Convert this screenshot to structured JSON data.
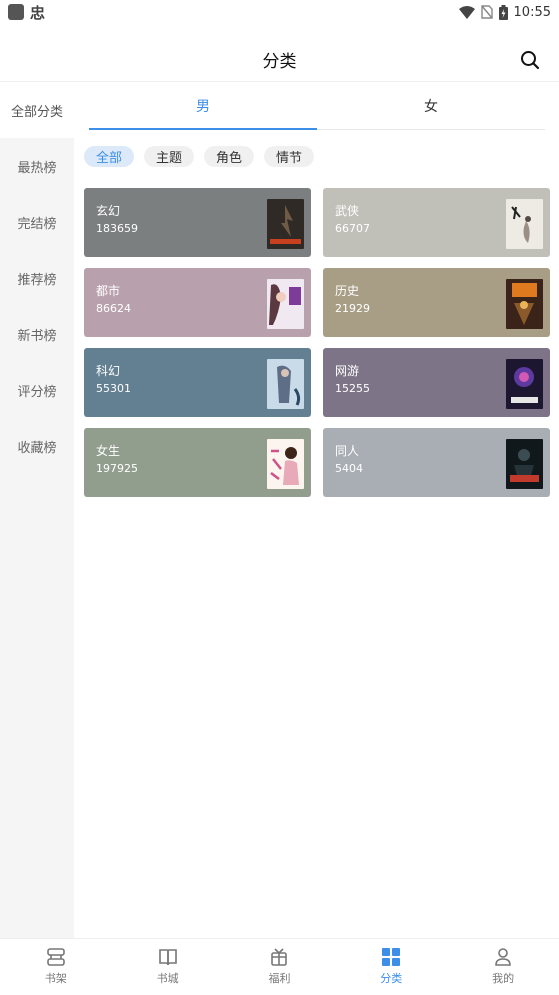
{
  "status_bar": {
    "glyph": "忠",
    "time": "10:55"
  },
  "header": {
    "title": "分类",
    "search_icon": "search-icon"
  },
  "sidebar": {
    "items": [
      {
        "label": "全部分类",
        "active": true
      },
      {
        "label": "最热榜",
        "active": false
      },
      {
        "label": "完结榜",
        "active": false
      },
      {
        "label": "推荐榜",
        "active": false
      },
      {
        "label": "新书榜",
        "active": false
      },
      {
        "label": "评分榜",
        "active": false
      },
      {
        "label": "收藏榜",
        "active": false
      }
    ]
  },
  "gender_tabs": [
    {
      "label": "男",
      "active": true
    },
    {
      "label": "女",
      "active": false
    }
  ],
  "chips": [
    {
      "label": "全部",
      "active": true
    },
    {
      "label": "主题",
      "active": false
    },
    {
      "label": "角色",
      "active": false
    },
    {
      "label": "情节",
      "active": false
    }
  ],
  "categories": [
    {
      "name": "玄幻",
      "count": "183659",
      "color": "#7b7f80"
    },
    {
      "name": "武侠",
      "count": "66707",
      "color": "#c0c0b9"
    },
    {
      "name": "都市",
      "count": "86624",
      "color": "#b9a0ad"
    },
    {
      "name": "历史",
      "count": "21929",
      "color": "#a89e85"
    },
    {
      "name": "科幻",
      "count": "55301",
      "color": "#637f92"
    },
    {
      "name": "网游",
      "count": "15255",
      "color": "#7e7487"
    },
    {
      "name": "女生",
      "count": "197925",
      "color": "#919e8e"
    },
    {
      "name": "同人",
      "count": "5404",
      "color": "#a9aeb5"
    }
  ],
  "bottom_nav": [
    {
      "label": "书架",
      "icon": "bookshelf-icon",
      "active": false
    },
    {
      "label": "书城",
      "icon": "book-icon",
      "active": false
    },
    {
      "label": "福利",
      "icon": "gift-icon",
      "active": false
    },
    {
      "label": "分类",
      "icon": "grid-icon",
      "active": true
    },
    {
      "label": "我的",
      "icon": "user-icon",
      "active": false
    }
  ],
  "colors": {
    "accent": "#3d8ee8",
    "sidebar_bg": "#f5f5f5",
    "chip_active_bg": "#dce9f8"
  }
}
